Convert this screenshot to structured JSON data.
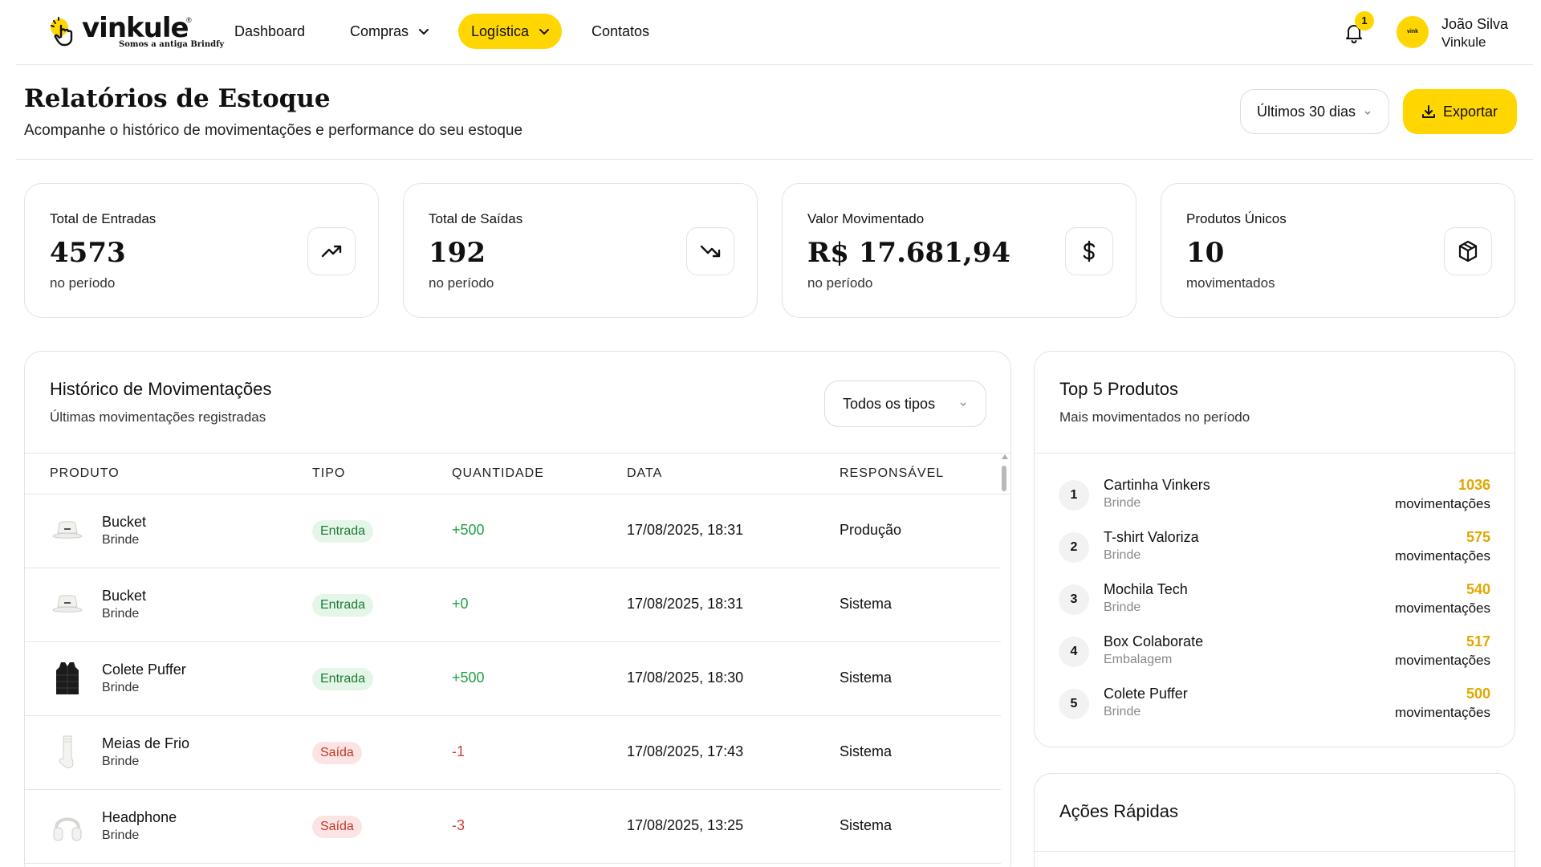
{
  "brand": {
    "name": "vinkule",
    "registered": "®",
    "tagline": "Somos a antiga Brindfy",
    "accent": "#FFD600"
  },
  "nav": {
    "items": [
      {
        "label": "Dashboard",
        "icon": null
      },
      {
        "label": "Compras",
        "icon": "chevron-down-icon"
      },
      {
        "label": "Logística",
        "icon": "chevron-down-icon",
        "active": true
      },
      {
        "label": "Contatos",
        "icon": null
      }
    ],
    "notifications_count": "1",
    "user": {
      "name": "João Silva",
      "org": "Vinkule",
      "avatar_text": "vink"
    }
  },
  "header": {
    "title": "Relatórios de Estoque",
    "subtitle": "Acompanhe o histórico de movimentações e performance do seu estoque",
    "period_value": "Últimos 30 dias",
    "export_label": "Exportar"
  },
  "stats": [
    {
      "label": "Total de Entradas",
      "value": "4573",
      "sub": "no período",
      "icon": "trending-up-icon"
    },
    {
      "label": "Total de Saídas",
      "value": "192",
      "sub": "no período",
      "icon": "trending-down-icon"
    },
    {
      "label": "Valor Movimentado",
      "value": "R$ 17.681,94",
      "sub": "no período",
      "icon": "dollar-icon"
    },
    {
      "label": "Produtos Únicos",
      "value": "10",
      "sub": "movimentados",
      "icon": "box-icon"
    }
  ],
  "history": {
    "title": "Histórico de Movimentações",
    "subtitle": "Últimas movimentações registradas",
    "filter_value": "Todos os tipos",
    "columns": [
      "PRODUTO",
      "TIPO",
      "QUANTIDADE",
      "DATA",
      "RESPONSÁVEL"
    ],
    "rows": [
      {
        "product": "Bucket",
        "category": "Brinde",
        "type": "Entrada",
        "quantity": "+500",
        "date": "17/08/2025, 18:31",
        "responsible": "Produção",
        "thumb": "bucket-hat-icon"
      },
      {
        "product": "Bucket",
        "category": "Brinde",
        "type": "Entrada",
        "quantity": "+0",
        "date": "17/08/2025, 18:31",
        "responsible": "Sistema",
        "thumb": "bucket-hat-icon"
      },
      {
        "product": "Colete Puffer",
        "category": "Brinde",
        "type": "Entrada",
        "quantity": "+500",
        "date": "17/08/2025, 18:30",
        "responsible": "Sistema",
        "thumb": "vest-icon"
      },
      {
        "product": "Meias de Frio",
        "category": "Brinde",
        "type": "Saída",
        "quantity": "-1",
        "date": "17/08/2025, 17:43",
        "responsible": "Sistema",
        "thumb": "socks-icon"
      },
      {
        "product": "Headphone",
        "category": "Brinde",
        "type": "Saída",
        "quantity": "-3",
        "date": "17/08/2025, 13:25",
        "responsible": "Sistema",
        "thumb": "headphone-icon"
      }
    ]
  },
  "top5": {
    "title": "Top 5 Produtos",
    "subtitle": "Mais movimentados no período",
    "items": [
      {
        "rank": "1",
        "name": "Cartinha Vinkers",
        "category": "Brinde",
        "count": "1036",
        "unit": "movimentações"
      },
      {
        "rank": "2",
        "name": "T-shirt Valoriza",
        "category": "Brinde",
        "count": "575",
        "unit": "movimentações"
      },
      {
        "rank": "3",
        "name": "Mochila Tech",
        "category": "Brinde",
        "count": "540",
        "unit": "movimentações"
      },
      {
        "rank": "4",
        "name": "Box Colaborate",
        "category": "Embalagem",
        "count": "517",
        "unit": "movimentações"
      },
      {
        "rank": "5",
        "name": "Colete Puffer",
        "category": "Brinde",
        "count": "500",
        "unit": "movimentações"
      }
    ]
  },
  "quick_actions": {
    "title": "Ações Rápidas"
  }
}
